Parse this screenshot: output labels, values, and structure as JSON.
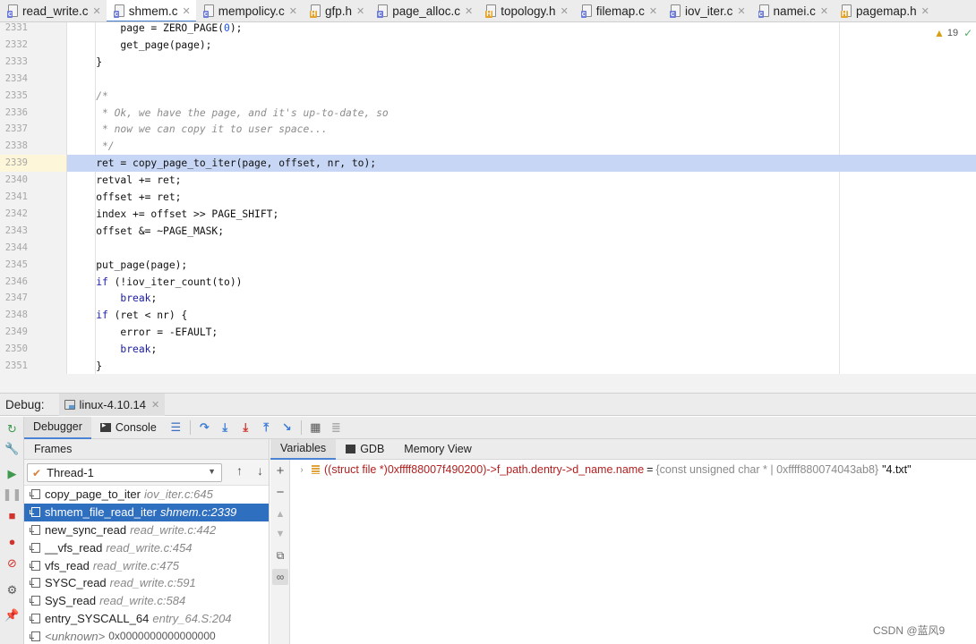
{
  "tabs": [
    {
      "label": "read_write.c",
      "type": "c",
      "active": false
    },
    {
      "label": "shmem.c",
      "type": "c",
      "active": true
    },
    {
      "label": "mempolicy.c",
      "type": "c",
      "active": false
    },
    {
      "label": "gfp.h",
      "type": "h",
      "active": false
    },
    {
      "label": "page_alloc.c",
      "type": "c",
      "active": false
    },
    {
      "label": "topology.h",
      "type": "h",
      "active": false
    },
    {
      "label": "filemap.c",
      "type": "c",
      "active": false
    },
    {
      "label": "iov_iter.c",
      "type": "c",
      "active": false
    },
    {
      "label": "namei.c",
      "type": "c",
      "active": false
    },
    {
      "label": "pagemap.h",
      "type": "h",
      "active": false
    }
  ],
  "editor": {
    "highlight_line": "2339",
    "inspection": {
      "warning_icon": "warning-icon",
      "count": "19",
      "ok_icon": "check-icon"
    },
    "lines": [
      {
        "n": "2331",
        "segs": [
          {
            "t": "        page = ZERO_PAGE(",
            "c": ""
          },
          {
            "t": "0",
            "c": "num"
          },
          {
            "t": ");",
            "c": ""
          }
        ]
      },
      {
        "n": "2332",
        "segs": [
          {
            "t": "        get_page(page);",
            "c": ""
          }
        ]
      },
      {
        "n": "2333",
        "segs": [
          {
            "t": "    }",
            "c": ""
          }
        ]
      },
      {
        "n": "2334",
        "segs": []
      },
      {
        "n": "2335",
        "segs": [
          {
            "t": "    /*",
            "c": "cm"
          }
        ]
      },
      {
        "n": "2336",
        "segs": [
          {
            "t": "     * Ok, we have the page, and it's up-to-date, so",
            "c": "cm"
          }
        ]
      },
      {
        "n": "2337",
        "segs": [
          {
            "t": "     * now we can copy it to user space...",
            "c": "cm"
          }
        ]
      },
      {
        "n": "2338",
        "segs": [
          {
            "t": "     */",
            "c": "cm"
          }
        ]
      },
      {
        "n": "2339",
        "segs": [
          {
            "t": "    ret = copy_page_to_iter(page, offset, nr, to);",
            "c": ""
          }
        ]
      },
      {
        "n": "2340",
        "segs": [
          {
            "t": "    retval += ret;",
            "c": ""
          }
        ]
      },
      {
        "n": "2341",
        "segs": [
          {
            "t": "    offset += ret;",
            "c": ""
          }
        ]
      },
      {
        "n": "2342",
        "segs": [
          {
            "t": "    index += offset >> PAGE_SHIFT;",
            "c": ""
          }
        ]
      },
      {
        "n": "2343",
        "segs": [
          {
            "t": "    offset &= ~PAGE_MASK;",
            "c": ""
          }
        ]
      },
      {
        "n": "2344",
        "segs": []
      },
      {
        "n": "2345",
        "segs": [
          {
            "t": "    put_page(page);",
            "c": ""
          }
        ]
      },
      {
        "n": "2346",
        "segs": [
          {
            "t": "    ",
            "c": ""
          },
          {
            "t": "if",
            "c": "kw"
          },
          {
            "t": " (!iov_iter_count(to))",
            "c": ""
          }
        ]
      },
      {
        "n": "2347",
        "segs": [
          {
            "t": "        ",
            "c": ""
          },
          {
            "t": "break",
            "c": "kw"
          },
          {
            "t": ";",
            "c": ""
          }
        ]
      },
      {
        "n": "2348",
        "segs": [
          {
            "t": "    ",
            "c": ""
          },
          {
            "t": "if",
            "c": "kw"
          },
          {
            "t": " (ret < nr) {",
            "c": ""
          }
        ]
      },
      {
        "n": "2349",
        "segs": [
          {
            "t": "        error = -EFAULT;",
            "c": ""
          }
        ]
      },
      {
        "n": "2350",
        "segs": [
          {
            "t": "        ",
            "c": ""
          },
          {
            "t": "break",
            "c": "kw"
          },
          {
            "t": ";",
            "c": ""
          }
        ]
      },
      {
        "n": "2351",
        "segs": [
          {
            "t": "    }",
            "c": ""
          }
        ]
      }
    ]
  },
  "debug": {
    "title": "Debug:",
    "config_tab": "linux-4.10.14",
    "debugger_tab": "Debugger",
    "console_tab": "Console",
    "frames_title": "Frames",
    "thread": "Thread-1",
    "frames": [
      {
        "func": "copy_page_to_iter",
        "loc": "iov_iter.c:645",
        "selected": false
      },
      {
        "func": "shmem_file_read_iter",
        "loc": "shmem.c:2339",
        "selected": true
      },
      {
        "func": "new_sync_read",
        "loc": "read_write.c:442",
        "selected": false
      },
      {
        "func": "__vfs_read",
        "loc": "read_write.c:454",
        "selected": false
      },
      {
        "func": "vfs_read",
        "loc": "read_write.c:475",
        "selected": false
      },
      {
        "func": "SYSC_read",
        "loc": "read_write.c:591",
        "selected": false
      },
      {
        "func": "SyS_read",
        "loc": "read_write.c:584",
        "selected": false
      },
      {
        "func": "entry_SYSCALL_64",
        "loc": "entry_64.S:204",
        "selected": false
      },
      {
        "func": "<unknown>",
        "loc": "",
        "addr": "0x0000000000000000",
        "selected": false
      }
    ],
    "var_tabs": [
      "Variables",
      "GDB",
      "Memory View"
    ],
    "variable": {
      "name": "((struct file *)0xffff88007f490200)->f_path.dentry->d_name.name",
      "eq": "=",
      "type": "{const unsigned char * | 0xffff880074043ab8}",
      "value": "\"4.txt\""
    }
  },
  "watermark": "CSDN @蓝风9",
  "colors": {
    "selection": "#2f6fbf",
    "highlight_line": "#c6d6f4",
    "keyword": "#1a1aa6",
    "var_name": "#b11f1f"
  }
}
